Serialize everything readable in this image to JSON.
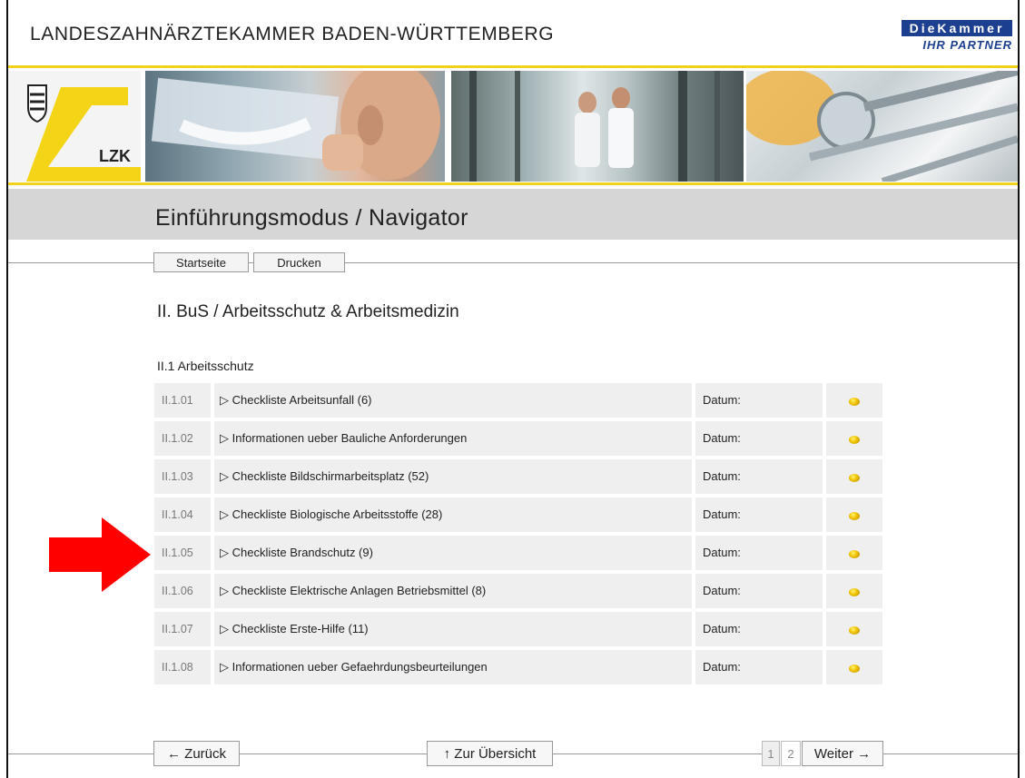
{
  "header": {
    "org_title": "LANDESZAHNÄRZTEKAMMER BADEN-WÜRTTEMBERG",
    "partner_logo_top": "DieKammer",
    "partner_logo_bottom": "IHR PARTNER",
    "lzk_label": "LZK"
  },
  "page_title": "Einführungsmodus / Navigator",
  "toolbar": {
    "home_label": "Startseite",
    "print_label": "Drucken"
  },
  "section_title": "II. BuS / Arbeitsschutz & Arbeitsmedizin",
  "subsection_title": "II.1 Arbeitsschutz",
  "rows": [
    {
      "num": "II.1.01",
      "title": "▷ Checkliste Arbeitsunfall (6)",
      "date": "Datum:"
    },
    {
      "num": "II.1.02",
      "title": "▷ Informationen ueber Bauliche Anforderungen",
      "date": "Datum:"
    },
    {
      "num": "II.1.03",
      "title": "▷ Checkliste Bildschirmarbeitsplatz (52)",
      "date": "Datum:"
    },
    {
      "num": "II.1.04",
      "title": "▷ Checkliste Biologische Arbeitsstoffe (28)",
      "date": "Datum:"
    },
    {
      "num": "II.1.05",
      "title": "▷ Checkliste Brandschutz (9)",
      "date": "Datum:"
    },
    {
      "num": "II.1.06",
      "title": "▷ Checkliste Elektrische Anlagen Betriebsmittel (8)",
      "date": "Datum:"
    },
    {
      "num": "II.1.07",
      "title": "▷ Checkliste Erste-Hilfe (11)",
      "date": "Datum:"
    },
    {
      "num": "II.1.08",
      "title": "▷ Informationen ueber Gefaehrdungsbeurteilungen",
      "date": "Datum:"
    }
  ],
  "footer": {
    "back_label": "← Zurück",
    "overview_label": "↑ Zur Übersicht",
    "page1": "1",
    "page2": "2",
    "next_label": "Weiter →"
  },
  "colors": {
    "accent_yellow": "#f0d21a",
    "partner_blue": "#1d3f8f",
    "status_dot": "#f2c500",
    "annotation_arrow": "#ff0000"
  }
}
